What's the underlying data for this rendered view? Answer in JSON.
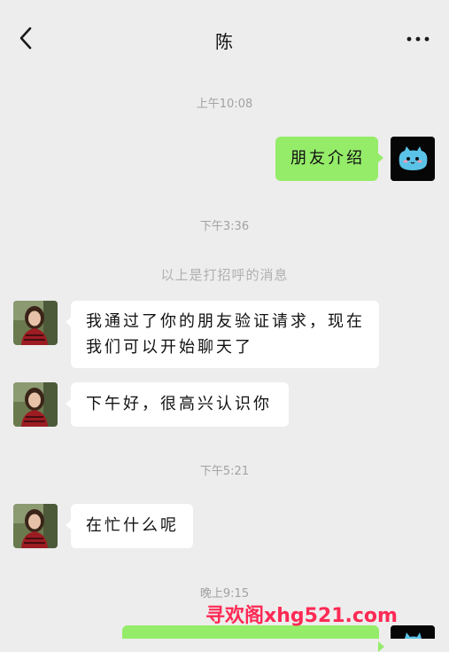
{
  "header": {
    "title": "陈",
    "back_icon": "chevron-left-icon",
    "more_icon": "more-horizontal-icon"
  },
  "messages": {
    "t1": "上午10:08",
    "m1": "朋友介绍",
    "t2": "下午3:36",
    "sys1": "以上是打招呼的消息",
    "m2_line1": "我通过了你的朋友验证请求，现在",
    "m2_line2": "我们可以开始聊天了",
    "m3": "下午好，很高兴认识你",
    "t3": "下午5:21",
    "m4": "在忙什么呢",
    "t4": "晚上9:15"
  },
  "watermark": "寻欢阁xhg521.com",
  "colors": {
    "background": "#ededed",
    "outgoing_bubble": "#95ec69",
    "incoming_bubble": "#ffffff",
    "watermark": "#ff2a55"
  }
}
